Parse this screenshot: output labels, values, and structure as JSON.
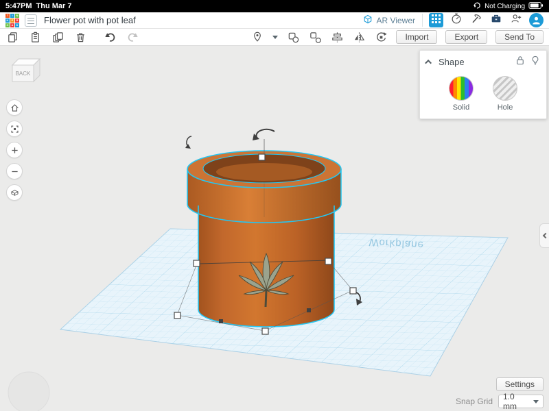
{
  "status_bar": {
    "time": "5:47PM",
    "date": "Thu Mar 7",
    "battery_status": "Not Charging"
  },
  "top_bar": {
    "logo_letters": [
      "T",
      "I",
      "N",
      "K",
      "E",
      "R",
      "C",
      "A",
      "D"
    ],
    "title": "Flower pot with pot leaf",
    "ar_viewer_label": "AR Viewer"
  },
  "action_bar": {
    "import_label": "Import",
    "export_label": "Export",
    "send_to_label": "Send To"
  },
  "shape_panel": {
    "title": "Shape",
    "options": [
      {
        "label": "Solid"
      },
      {
        "label": "Hole"
      }
    ]
  },
  "view_cube": {
    "face_label": "BACK"
  },
  "scene": {
    "workplane_label": "Workplane",
    "object_name": "flower pot with cannabis leaf emblem"
  },
  "footer": {
    "settings_label": "Settings",
    "snap_grid_label": "Snap Grid",
    "snap_grid_value": "1.0 mm"
  },
  "colors": {
    "accent_blue": "#1d9bd7",
    "pot_orange": "#c2672a",
    "pot_interior": "#7e421a",
    "leaf_green": "#9ba38d",
    "selection_cyan": "#25c6f2",
    "workplane_grid": "#c7e5f3",
    "canvas_background": "#ebebea"
  }
}
